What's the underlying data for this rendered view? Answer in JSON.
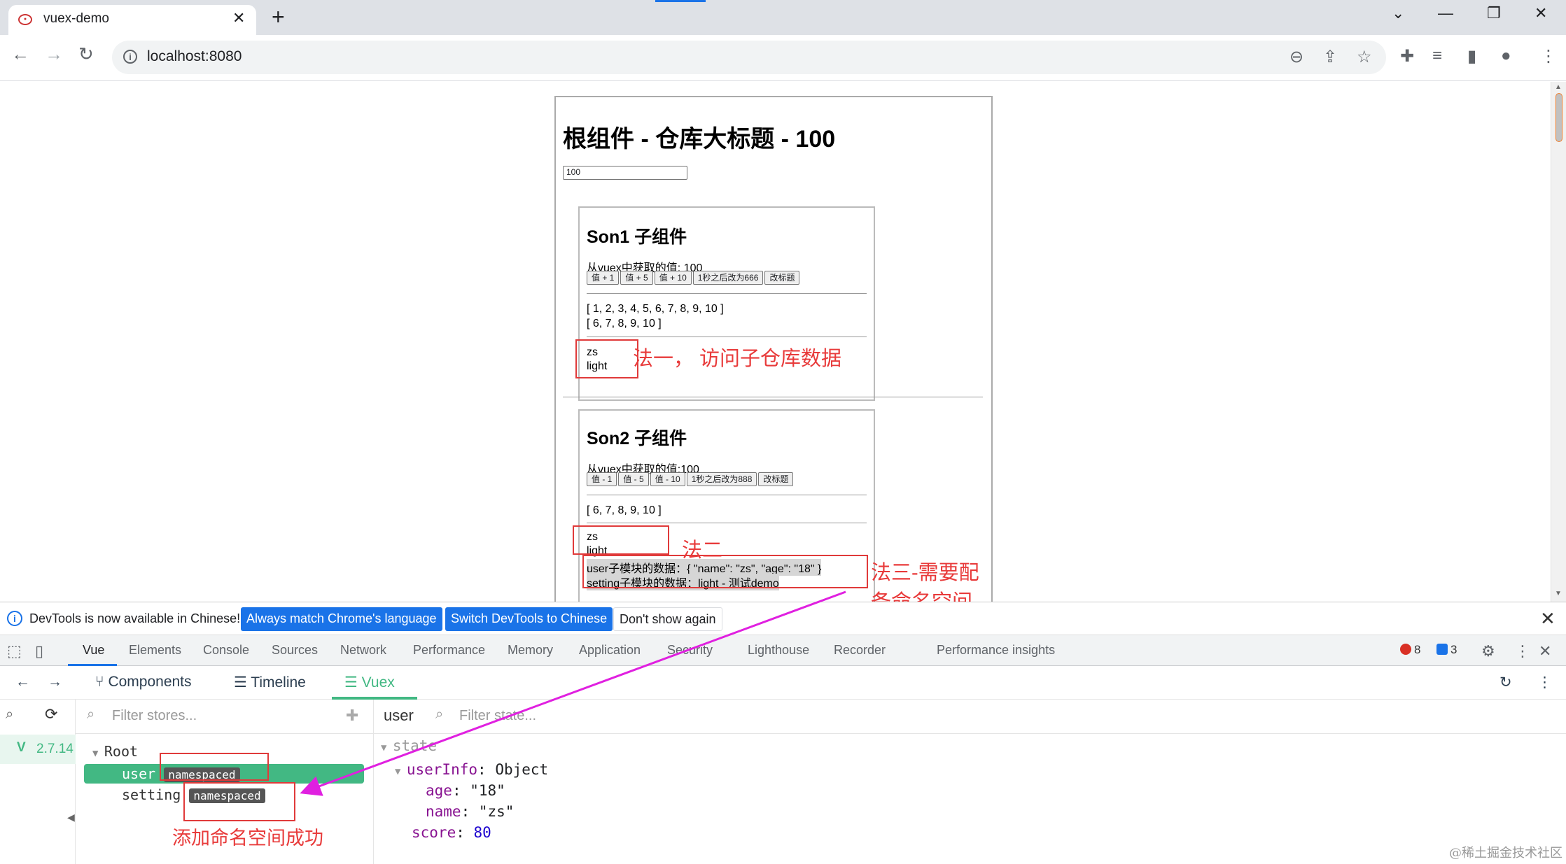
{
  "browser": {
    "tab_title": "vuex-demo",
    "url": "localhost:8080"
  },
  "page": {
    "root_title": "根组件 - 仓库大标题 - 100",
    "root_input_value": "100",
    "son1": {
      "title": "Son1 子组件",
      "value_line": "从vuex中获取的值: 100",
      "buttons": [
        "值 + 1",
        "值 + 5",
        "值 + 10",
        "1秒之后改为666",
        "改标题"
      ],
      "list_all": "[ 1, 2, 3, 4, 5, 6, 7, 8, 9, 10 ]",
      "list_filtered": "[ 6, 7, 8, 9, 10 ]",
      "user_name": "zs",
      "theme": "light"
    },
    "son2": {
      "title": "Son2 子组件",
      "value_line": "从vuex中获取的值:100",
      "buttons": [
        "值 - 1",
        "值 - 5",
        "值 - 10",
        "1秒之后改为888",
        "改标题"
      ],
      "list_filtered": "[ 6, 7, 8, 9, 10 ]",
      "user_name": "zs",
      "theme": "light",
      "user_module_line": "user子模块的数据：{ \"name\": \"zs\", \"age\": \"18\" }",
      "setting_module_line": "setting子模块的数据：light - 测试demo"
    }
  },
  "annotations": {
    "method1": "法一， 访问子仓库数据",
    "method2": "法二",
    "method3": "法三-需要配备命名空间",
    "namespace_ok": "添加命名空间成功"
  },
  "devtools": {
    "infobar": {
      "text": "DevTools is now available in Chinese!",
      "btn_match": "Always match Chrome's language",
      "btn_switch": "Switch DevTools to Chinese",
      "btn_dismiss": "Don't show again"
    },
    "tabs": [
      "Vue",
      "Elements",
      "Console",
      "Sources",
      "Network",
      "Performance",
      "Memory",
      "Application",
      "Security",
      "Lighthouse",
      "Recorder",
      "Performance insights"
    ],
    "errors": "8",
    "messages": "3",
    "vue_nav": {
      "components": "Components",
      "timeline": "Timeline",
      "vuex": "Vuex"
    },
    "vue_version": "2.7.14",
    "filter_stores_placeholder": "Filter stores...",
    "filter_state_placeholder": "Filter state...",
    "selected_store": "user",
    "tree": {
      "root": "Root",
      "user": "user",
      "setting": "setting",
      "badge": "namespaced"
    },
    "state": {
      "section": "state",
      "userInfo_key": "userInfo",
      "userInfo_type": "Object",
      "age_key": "age",
      "age_value": "\"18\"",
      "name_key": "name",
      "name_value": "\"zs\"",
      "score_key": "score",
      "score_value": "80"
    }
  },
  "watermark": "@稀土掘金技术社区",
  "colors": {
    "vue_green": "#42b883",
    "annotation_red": "#e83a3a",
    "arrow_magenta": "#e020e0",
    "chrome_blue": "#1a73e8"
  }
}
